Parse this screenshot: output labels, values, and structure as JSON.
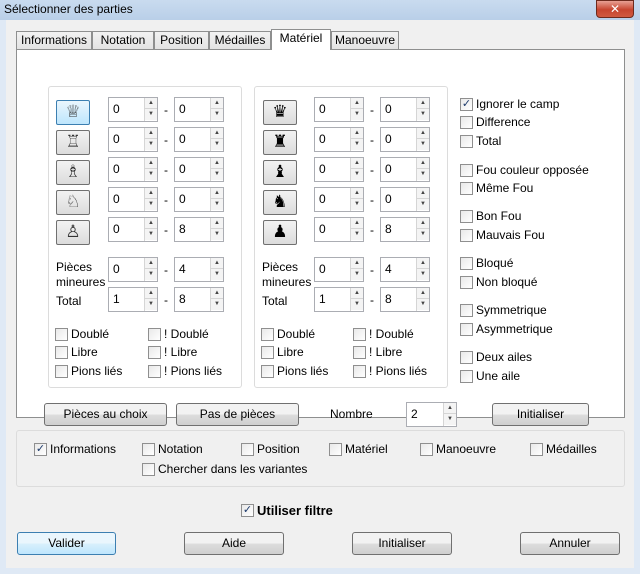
{
  "window": {
    "title": "Sélectionner des parties",
    "close_label": "✕"
  },
  "tabs": [
    "Informations",
    "Notation",
    "Position",
    "Médailles",
    "Matériel",
    "Manoeuvre"
  ],
  "tabs_active": 4,
  "material": {
    "white": {
      "pieces": [
        {
          "icon": "white-queen-icon",
          "glyph": "♕",
          "min": "0",
          "max": "0"
        },
        {
          "icon": "white-rook-icon",
          "glyph": "♖",
          "min": "0",
          "max": "0"
        },
        {
          "icon": "white-bishop-icon",
          "glyph": "♗",
          "min": "0",
          "max": "0"
        },
        {
          "icon": "white-knight-icon",
          "glyph": "♘",
          "min": "0",
          "max": "0"
        },
        {
          "icon": "white-pawn-icon",
          "glyph": "♙",
          "min": "0",
          "max": "8"
        }
      ],
      "minor": {
        "label_1": "Pièces",
        "label_2": "mineures",
        "min": "0",
        "max": "4"
      },
      "total": {
        "label": "Total",
        "min": "1",
        "max": "8"
      },
      "options": [
        {
          "label": "Doublé",
          "checked": false
        },
        {
          "label": "! Doublé",
          "checked": false
        },
        {
          "label": "Libre",
          "checked": false
        },
        {
          "label": "! Libre",
          "checked": false
        },
        {
          "label": "Pions liés",
          "checked": false
        },
        {
          "label": "! Pions liés",
          "checked": false
        }
      ]
    },
    "black": {
      "pieces": [
        {
          "icon": "black-queen-icon",
          "glyph": "♛",
          "min": "0",
          "max": "0"
        },
        {
          "icon": "black-rook-icon",
          "glyph": "♜",
          "min": "0",
          "max": "0"
        },
        {
          "icon": "black-bishop-icon",
          "glyph": "♝",
          "min": "0",
          "max": "0"
        },
        {
          "icon": "black-knight-icon",
          "glyph": "♞",
          "min": "0",
          "max": "0"
        },
        {
          "icon": "black-pawn-icon",
          "glyph": "♟",
          "min": "0",
          "max": "8"
        }
      ],
      "minor": {
        "label_1": "Pièces",
        "label_2": "mineures",
        "min": "0",
        "max": "4"
      },
      "total": {
        "label": "Total",
        "min": "1",
        "max": "8"
      },
      "options": [
        {
          "label": "Doublé",
          "checked": false
        },
        {
          "label": "! Doublé",
          "checked": false
        },
        {
          "label": "Libre",
          "checked": false
        },
        {
          "label": "! Libre",
          "checked": false
        },
        {
          "label": "Pions liés",
          "checked": false
        },
        {
          "label": "! Pions liés",
          "checked": false
        }
      ]
    },
    "right_options": [
      {
        "label": "Ignorer le camp",
        "checked": true
      },
      {
        "label": "Difference",
        "checked": false
      },
      {
        "label": "Total",
        "checked": false
      },
      {
        "label": "Fou couleur opposée",
        "checked": false
      },
      {
        "label": "Même Fou",
        "checked": false
      },
      {
        "label": "Bon Fou",
        "checked": false
      },
      {
        "label": "Mauvais Fou",
        "checked": false
      },
      {
        "label": "Bloqué",
        "checked": false
      },
      {
        "label": "Non bloqué",
        "checked": false
      },
      {
        "label": "Symmetrique",
        "checked": false
      },
      {
        "label": "Asymmetrique",
        "checked": false
      },
      {
        "label": "Deux ailes",
        "checked": false
      },
      {
        "label": "Une aile",
        "checked": false
      }
    ],
    "buttons": {
      "choice": "Pièces au choix",
      "none": "Pas de pièces",
      "reset": "Initialiser"
    },
    "count": {
      "label": "Nombre",
      "value": "2"
    }
  },
  "filters": [
    {
      "label": "Informations",
      "checked": true
    },
    {
      "label": "Notation",
      "checked": false
    },
    {
      "label": "Position",
      "checked": false
    },
    {
      "label": "Matériel",
      "checked": false
    },
    {
      "label": "Manoeuvre",
      "checked": false
    },
    {
      "label": "Médailles",
      "checked": false
    },
    {
      "label": "Chercher dans les variantes",
      "checked": false
    }
  ],
  "use_filter": {
    "label": "Utiliser filtre",
    "checked": true
  },
  "footer": {
    "ok": "Valider",
    "help": "Aide",
    "reset": "Initialiser",
    "cancel": "Annuler"
  }
}
